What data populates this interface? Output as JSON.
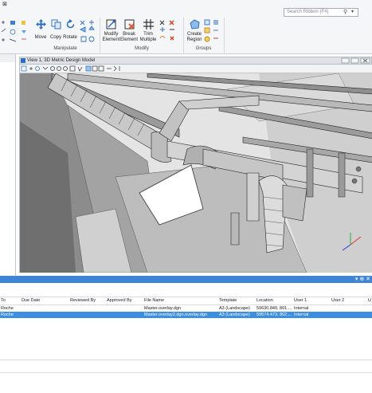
{
  "ribbon": {
    "search_placeholder": "Search Ribbon (F4)",
    "manipulate": {
      "label": "Manipulate",
      "buttons": [
        {
          "label": "Move",
          "icon": "move-icon"
        },
        {
          "label": "Copy",
          "icon": "copy-icon"
        },
        {
          "label": "Rotate",
          "icon": "rotate-icon"
        }
      ]
    },
    "modify": {
      "label": "Modify",
      "buttons": [
        {
          "label": "Modify\nElement",
          "icon": "modify-element-icon"
        },
        {
          "label": "Break\nElement",
          "icon": "break-element-icon"
        },
        {
          "label": "Trim\nMultiple",
          "icon": "trim-multiple-icon"
        }
      ]
    },
    "groups": {
      "label": "Groups",
      "buttons": [
        {
          "label": "Create\nRegion",
          "icon": "create-region-icon"
        }
      ]
    }
  },
  "view": {
    "title": "View 1, 3D Metric Design Model"
  },
  "table": {
    "columns": [
      "To",
      "Due Date",
      "Reviewed By",
      "Approved By",
      "File Name",
      "Template",
      "Location",
      "User 1",
      "User 2",
      "U"
    ],
    "rows": [
      {
        "to": "Roche",
        "due_date": "",
        "reviewed_by": "",
        "approved_by": "",
        "file_name": "Master.overlay.dgn",
        "template": "A3 (Landscape)",
        "location": "59630.840, 801....",
        "user1": "Internal",
        "user2": "",
        "selected": false
      },
      {
        "to": "Roche",
        "due_date": "",
        "reviewed_by": "",
        "approved_by": "",
        "file_name": "Master.overlay2.dgn.overlay.dgn",
        "template": "A3 (Landscape)",
        "location": "59574.473, 802....",
        "user1": "Internal",
        "user2": "",
        "selected": true
      }
    ]
  },
  "colors": {
    "accent": "#3f84d6",
    "selected_row": "#3b8ee0",
    "ribbon_bg": "#f5f6f7"
  }
}
